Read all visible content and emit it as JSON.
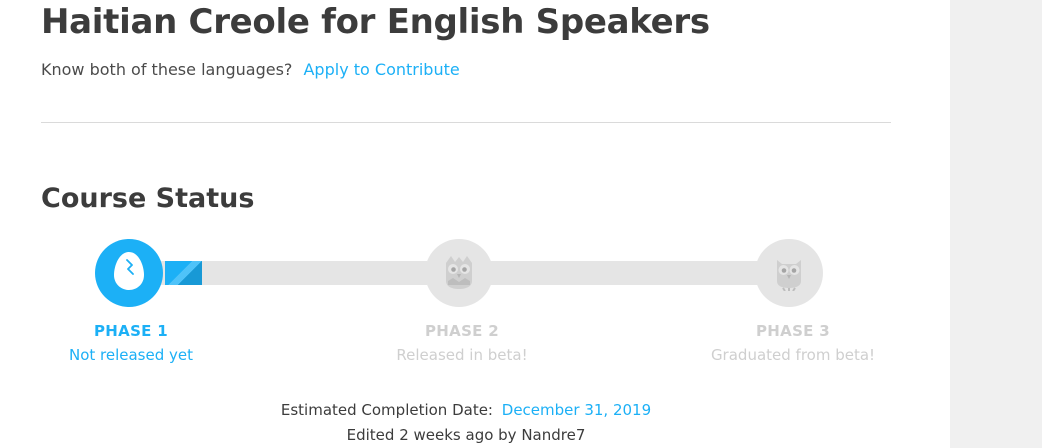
{
  "course": {
    "title": "Haitian Creole for English Speakers",
    "contribute_prompt": "Know both of these languages?",
    "contribute_link": "Apply to Contribute"
  },
  "status": {
    "heading": "Course Status",
    "progress_fraction": 0.14,
    "phases": [
      {
        "label": "PHASE 1",
        "subtitle": "Not released yet",
        "active": true,
        "icon": "egg-icon"
      },
      {
        "label": "PHASE 2",
        "subtitle": "Released in beta!",
        "active": false,
        "icon": "baby-owl-icon"
      },
      {
        "label": "PHASE 3",
        "subtitle": "Graduated from beta!",
        "active": false,
        "icon": "owl-icon"
      }
    ],
    "completion_label": "Estimated Completion Date:",
    "completion_date": "December 31, 2019",
    "edited_text": "Edited 2 weeks ago by Nandre7"
  },
  "colors": {
    "accent": "#1cb0f6",
    "inactive": "#e5e5e5",
    "inactive_text": "#cfcfcf",
    "text": "#3c3c3c"
  }
}
